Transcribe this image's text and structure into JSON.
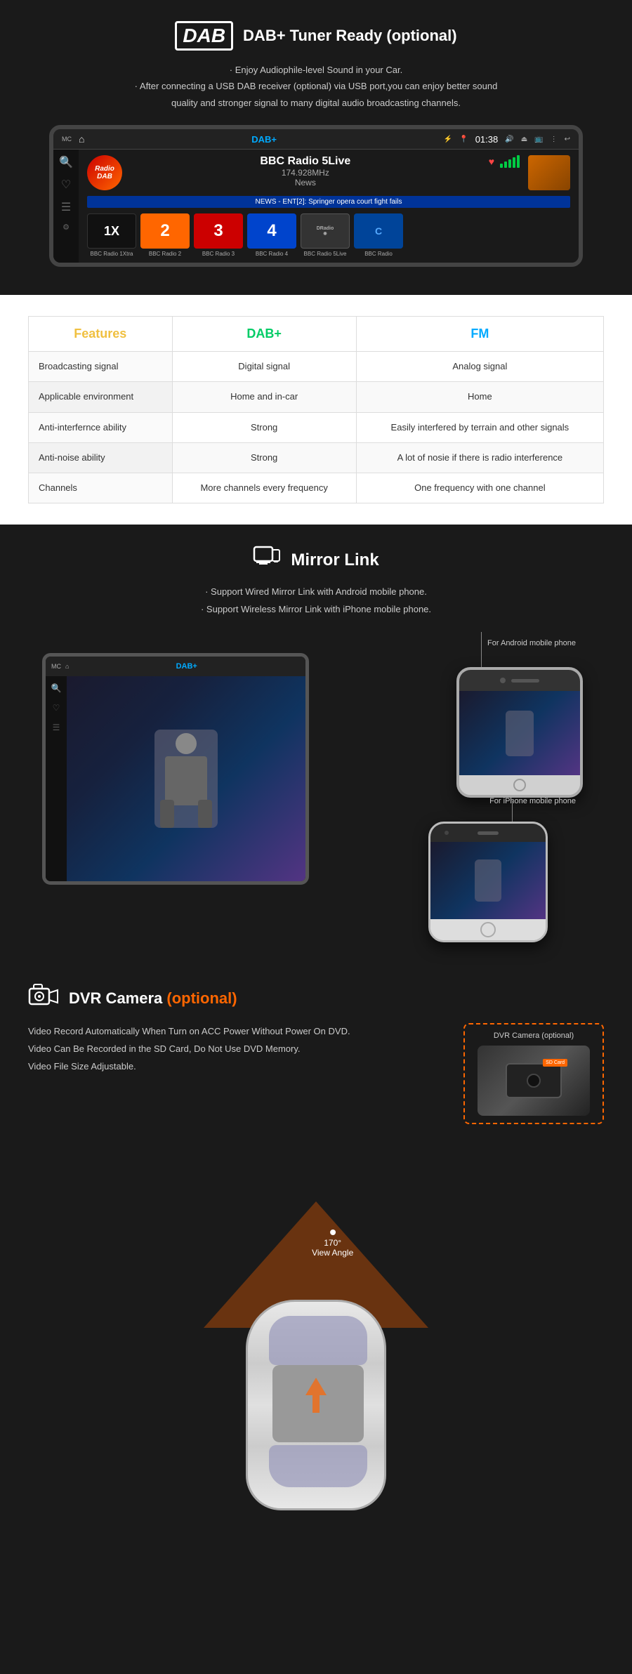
{
  "dab": {
    "logo": "DAB",
    "title": "DAB+ Tuner Ready (optional)",
    "desc_line1": "· Enjoy Audiophile-level Sound in your Car.",
    "desc_line2": "· After connecting a USB DAB receiver (optional) via USB port,you can enjoy better sound",
    "desc_line3": "quality and stronger signal to many digital audio broadcasting channels.",
    "screen": {
      "topbar_label": "MC",
      "label": "DAB+",
      "time": "01:38",
      "radio_name": "BBC Radio 5Live",
      "radio_freq": "174.928MHz",
      "radio_type": "News",
      "news_ticker": "NEWS - ENT[2]: Springer opera court fight fails",
      "channels": [
        {
          "name": "BBC Radio 1Xtra",
          "short": "1X",
          "color": "ch1"
        },
        {
          "name": "BBC Radio 2",
          "short": "2",
          "color": "ch2"
        },
        {
          "name": "BBC Radio 3",
          "short": "3",
          "color": "ch3"
        },
        {
          "name": "BBC Radio 4",
          "short": "4",
          "color": "ch4"
        },
        {
          "name": "BBC Radio 5Live",
          "short": "DRadio",
          "color": "ch5"
        },
        {
          "name": "BBC Radio",
          "short": "",
          "color": "ch6"
        }
      ]
    }
  },
  "features": {
    "col1_header": "Features",
    "col2_header": "DAB+",
    "col3_header": "FM",
    "rows": [
      {
        "feature": "Broadcasting signal",
        "dab": "Digital signal",
        "fm": "Analog signal"
      },
      {
        "feature": "Applicable environment",
        "dab": "Home and in-car",
        "fm": "Home"
      },
      {
        "feature": "Anti-interfernce ability",
        "dab": "Strong",
        "fm": "Easily interfered by terrain and other signals"
      },
      {
        "feature": "Anti-noise ability",
        "dab": "Strong",
        "fm": "A lot of nosie if there is radio interference"
      },
      {
        "feature": "Channels",
        "dab": "More channels every frequency",
        "fm": "One frequency with one channel"
      }
    ]
  },
  "mirror": {
    "title": "Mirror Link",
    "desc_line1": "· Support Wired Mirror Link with Android mobile phone.",
    "desc_line2": "· Support Wireless Mirror Link with iPhone mobile phone.",
    "android_label": "For Android mobile phone",
    "iphone_label": "For iPhone mobile phone"
  },
  "dvr": {
    "title_white": "DVR Camera",
    "title_orange": " (optional)",
    "camera_label": "DVR Camera (optional)",
    "desc_line1": "Video Record Automatically When Turn on ACC Power Without Power On DVD.",
    "desc_line2": "Video Can Be Recorded in the SD Card, Do Not Use DVD Memory.",
    "desc_line3": "Video File Size Adjustable.",
    "sd_label": "SD Card",
    "view_angle": "170°",
    "view_angle_sub": "View Angle"
  }
}
